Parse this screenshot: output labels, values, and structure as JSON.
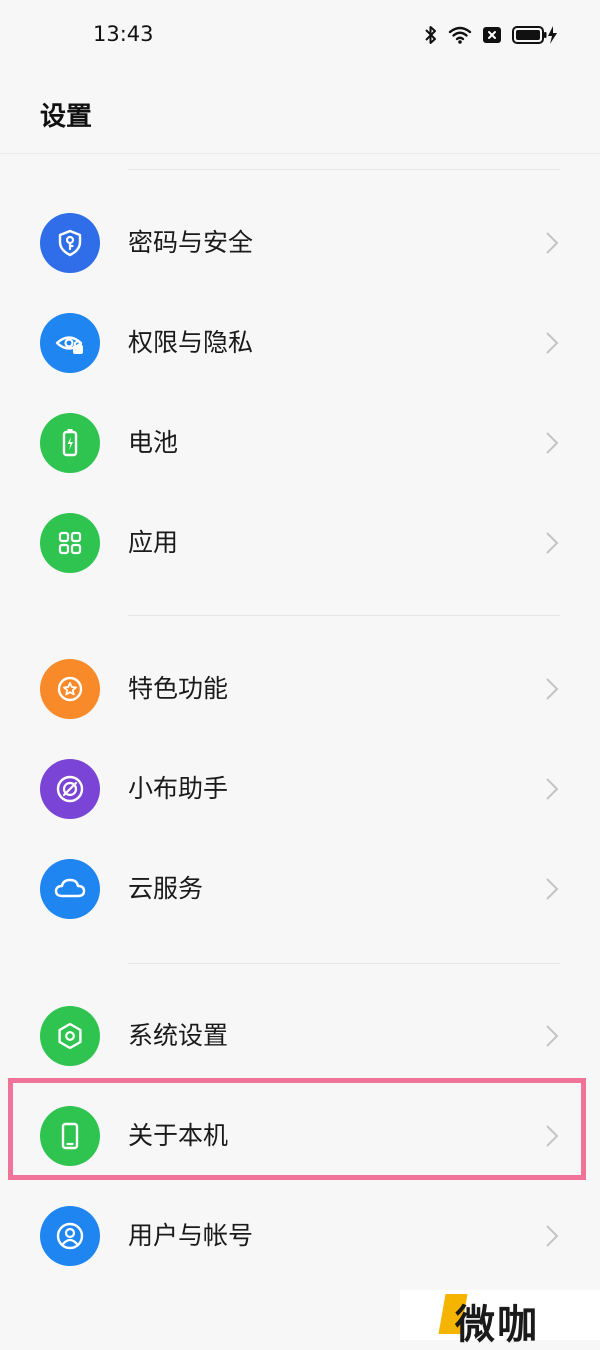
{
  "status_bar": {
    "time": "13:43",
    "icons": [
      "bluetooth-icon",
      "wifi-icon",
      "sim-no-signal-icon",
      "battery-charging-icon"
    ]
  },
  "header": {
    "title": "设置"
  },
  "settings": {
    "items": [
      {
        "label": "密码与安全",
        "icon": "shield-key-icon",
        "color": "#2f6ee8"
      },
      {
        "label": "权限与隐私",
        "icon": "eye-lock-icon",
        "color": "#1f85f0"
      },
      {
        "label": "电池",
        "icon": "battery-icon",
        "color": "#2ec44f"
      },
      {
        "label": "应用",
        "icon": "apps-grid-icon",
        "color": "#2ec44f"
      },
      {
        "label": "特色功能",
        "icon": "star-icon",
        "color": "#f88a2a"
      },
      {
        "label": "小布助手",
        "icon": "assistant-icon",
        "color": "#7a45d6"
      },
      {
        "label": "云服务",
        "icon": "cloud-icon",
        "color": "#1f85f0"
      },
      {
        "label": "系统设置",
        "icon": "hexagon-gear-icon",
        "color": "#2ec44f"
      },
      {
        "label": "关于本机",
        "icon": "phone-icon",
        "color": "#2ec44f"
      },
      {
        "label": "用户与帐号",
        "icon": "user-icon",
        "color": "#1f85f0"
      }
    ]
  },
  "highlight": {
    "color": "#f0739a",
    "target": "关于本机"
  },
  "watermark": {
    "text": "微咖"
  }
}
